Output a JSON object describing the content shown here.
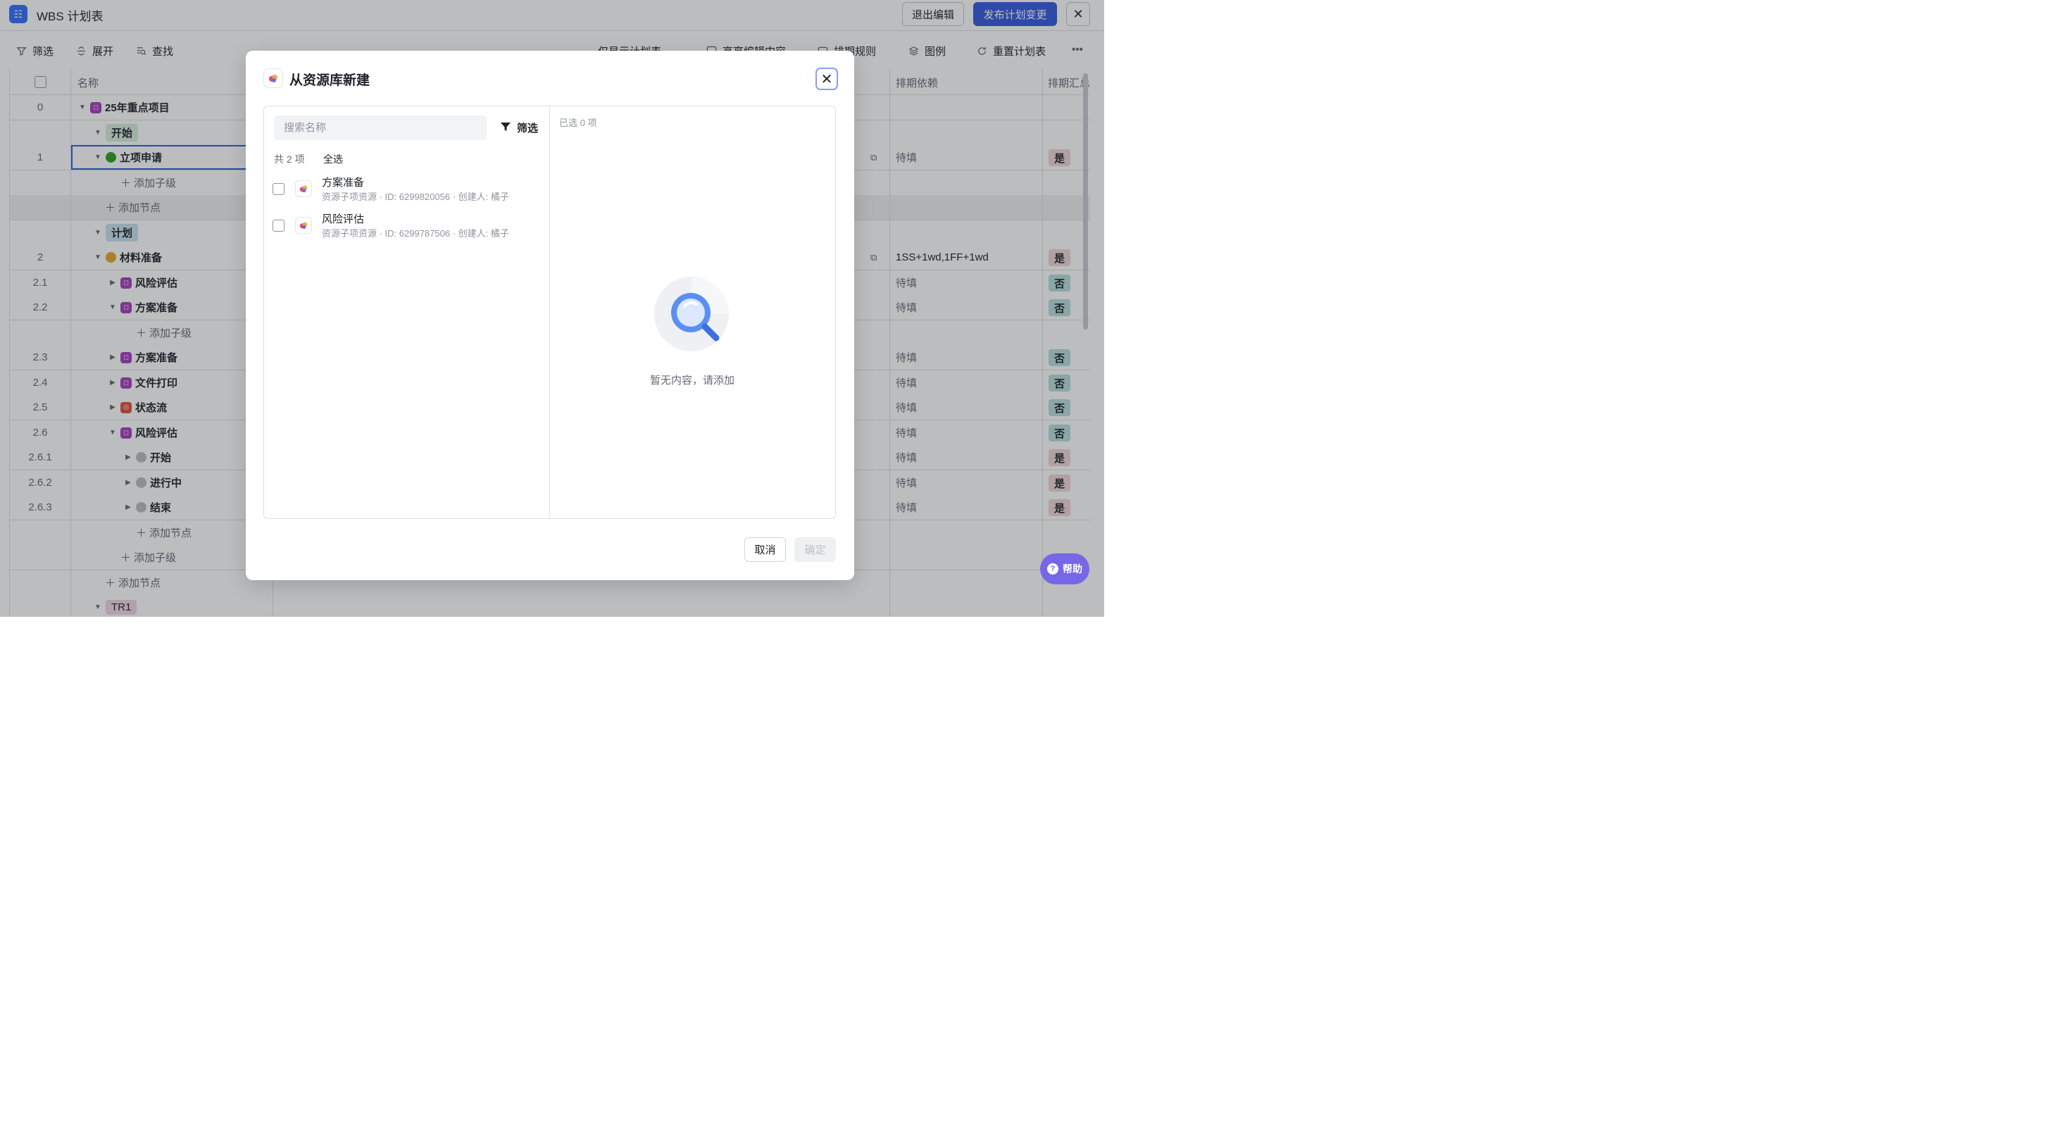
{
  "app": {
    "title": "WBS 计划表",
    "icon": "list-icon"
  },
  "header": {
    "exit_label": "退出编辑",
    "publish_label": "发布计划变更",
    "accent": "#3559e0"
  },
  "toolbar": {
    "filter": "筛选",
    "expand": "展开",
    "find": "查找",
    "plan_view": "仅显示计划表",
    "highlight": "高亮编辑内容",
    "rules": "排期规则",
    "legend": "图例",
    "reset": "重置计划表"
  },
  "table": {
    "col_name": "名称",
    "col_dependency": "排期依赖",
    "col_summary": "排期汇总",
    "rows": [
      {
        "num": "0",
        "name": "25年重点项目"
      },
      {
        "num": "",
        "name": "开始"
      },
      {
        "num": "1",
        "name": "立项申请",
        "dep": "待填",
        "summary": "是"
      },
      {
        "num": "",
        "name": "添加子级"
      },
      {
        "num": "",
        "name": "添加节点"
      },
      {
        "num": "",
        "name": "计划"
      },
      {
        "num": "2",
        "name": "材料准备",
        "dep": "1SS+1wd,1FF+1wd",
        "summary": "是"
      },
      {
        "num": "2.1",
        "name": "风险评估",
        "dep": "待填",
        "summary": "否"
      },
      {
        "num": "2.2",
        "name": "方案准备",
        "dep": "待填",
        "summary": "否"
      },
      {
        "num": "",
        "name": "添加子级"
      },
      {
        "num": "2.3",
        "name": "方案准备",
        "dep": "待填",
        "summary": "否"
      },
      {
        "num": "2.4",
        "name": "文件打印",
        "dep": "待填",
        "summary": "否"
      },
      {
        "num": "2.5",
        "name": "状态流",
        "dep": "待填",
        "summary": "否"
      },
      {
        "num": "2.6",
        "name": "风险评估",
        "dep": "待填",
        "summary": "否"
      },
      {
        "num": "2.6.1",
        "name": "开始",
        "dep": "待填",
        "summary": "是"
      },
      {
        "num": "2.6.2",
        "name": "进行中",
        "dep": "待填",
        "summary": "是"
      },
      {
        "num": "2.6.3",
        "name": "结束",
        "dep": "待填",
        "summary": "是"
      },
      {
        "num": "",
        "name": "添加节点"
      },
      {
        "num": "",
        "name": "添加子级"
      },
      {
        "num": "",
        "name": "添加节点"
      },
      {
        "num": "",
        "name": "TR1"
      }
    ]
  },
  "modal": {
    "title": "从资源库新建",
    "search_placeholder": "搜索名称",
    "filter_label": "筛选",
    "count": "共 2 项",
    "select_all": "全选",
    "selected": "已选 0 项",
    "empty_text": "暂无内容，请添加",
    "cancel": "取消",
    "confirm": "确定",
    "items": [
      {
        "name": "方案准备",
        "meta": "资源子项资源 · ID: 6299820056 · 创建人: 橘子"
      },
      {
        "name": "风险评估",
        "meta": "资源子项资源 · ID: 6299787506 · 创建人: 橘子"
      }
    ]
  },
  "help": {
    "label": "帮助"
  }
}
